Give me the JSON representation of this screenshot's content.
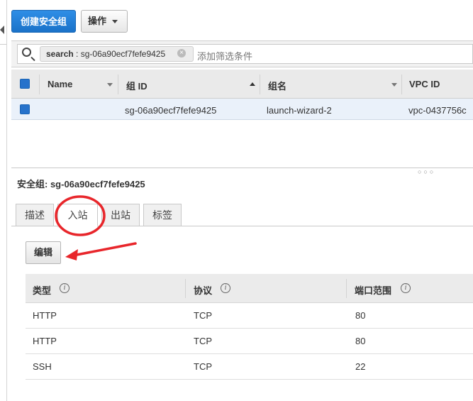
{
  "toolbar": {
    "create_label": "创建安全组",
    "actions_label": "操作"
  },
  "search": {
    "token_key": "search",
    "token_value": "sg-06a90ecf7fefe9425",
    "placeholder": "添加筛选条件"
  },
  "table": {
    "columns": [
      "Name",
      "组 ID",
      "组名",
      "VPC ID"
    ],
    "rows": [
      {
        "name": "",
        "group_id": "sg-06a90ecf7fefe9425",
        "group_name": "launch-wizard-2",
        "vpc_id": "vpc-0437756c"
      }
    ]
  },
  "details": {
    "title": "安全组: sg-06a90ecf7fefe9425",
    "tabs": [
      "描述",
      "入站",
      "出站",
      "标签"
    ],
    "active_tab": "入站",
    "edit_label": "编辑",
    "rule_columns": [
      "类型",
      "协议",
      "端口范围"
    ],
    "rules": [
      {
        "type": "HTTP",
        "protocol": "TCP",
        "port": "80"
      },
      {
        "type": "HTTP",
        "protocol": "TCP",
        "port": "80"
      },
      {
        "type": "SSH",
        "protocol": "TCP",
        "port": "22"
      }
    ]
  },
  "colors": {
    "primary": "#1f7ad6",
    "annotation": "#e8262b",
    "selected_row": "#eaf1fa"
  },
  "icons": {
    "search": "search-icon",
    "info": "info-icon",
    "close": "close-icon",
    "collapse": "collapse-left-icon"
  }
}
